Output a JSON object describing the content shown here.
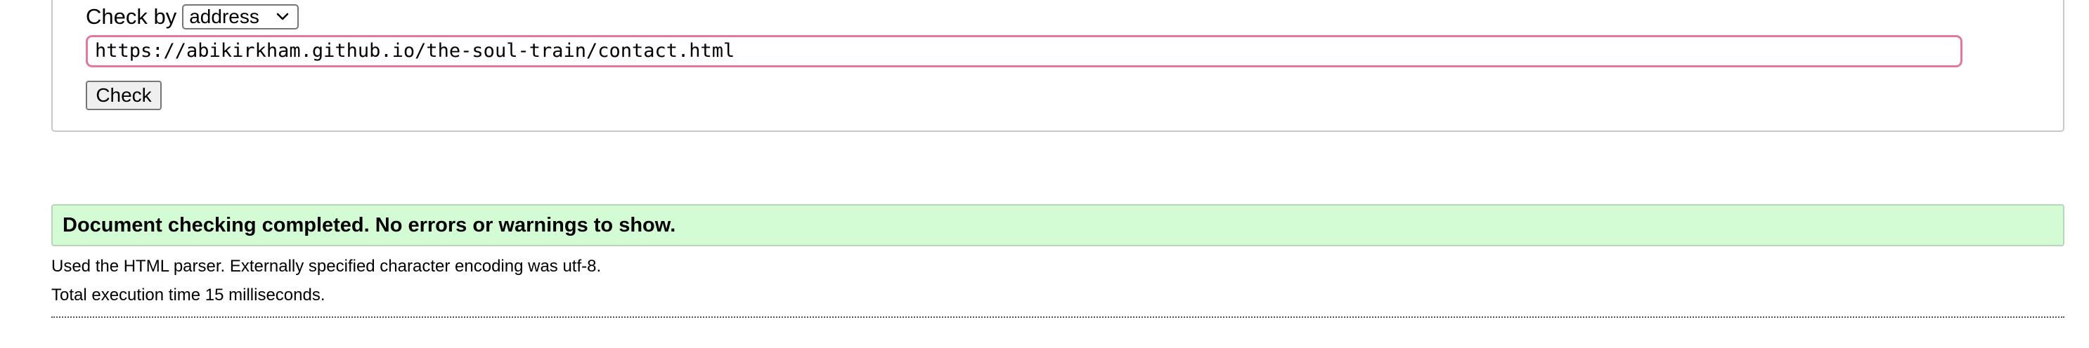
{
  "form": {
    "check_by_label": "Check by",
    "check_by_select": {
      "selected": "address"
    },
    "url_input": {
      "value": "https://abikirkham.github.io/the-soul-train/contact.html"
    },
    "check_button_label": "Check"
  },
  "results": {
    "success_message": "Document checking completed. No errors or warnings to show.",
    "parser_info": "Used the HTML parser. Externally specified character encoding was utf-8.",
    "execution_time": "Total execution time 15 milliseconds."
  },
  "colors": {
    "success_background": "#d4fcd4",
    "input_focus_border": "#e4779e"
  }
}
